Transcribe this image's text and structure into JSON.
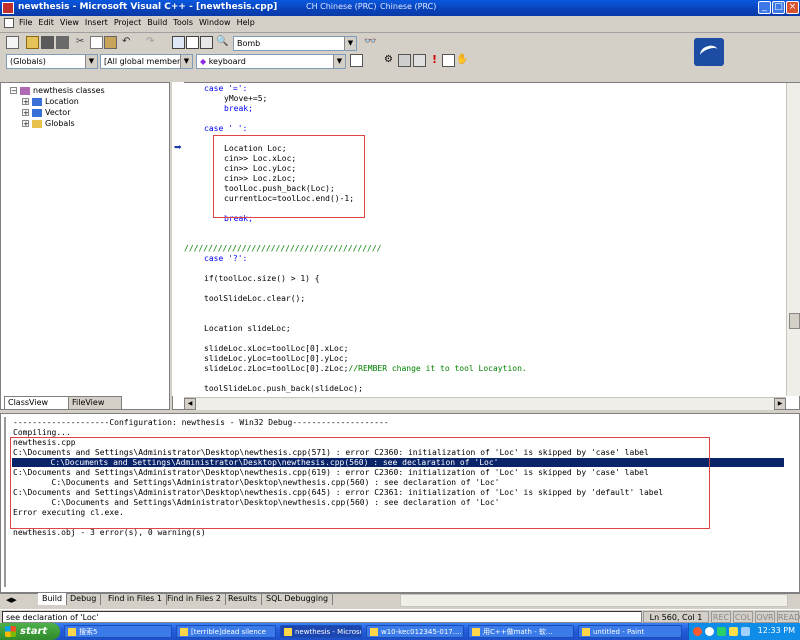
{
  "window": {
    "title": "newthesis - Microsoft Visual C++ - [newthesis.cpp]",
    "lang1": "CH Chinese (PRC)",
    "lang2": "Chinese (PRC)"
  },
  "menu": [
    "File",
    "Edit",
    "View",
    "Insert",
    "Project",
    "Build",
    "Tools",
    "Window",
    "Help"
  ],
  "toolbar": {
    "find_combo": "Bomb",
    "globals_combo": "(Globals)",
    "members_combo": "[All global members",
    "function_combo": "keyboard"
  },
  "classview": {
    "root": "newthesis classes",
    "items": [
      "Location",
      "Vector",
      "Globals"
    ],
    "tabs": [
      "ClassView",
      "FileView"
    ]
  },
  "code": [
    {
      "t": "case '=':",
      "x": 30,
      "k": true
    },
    {
      "t": "yMove+=5;",
      "x": 50
    },
    {
      "t": "break;",
      "x": 50,
      "k": true
    },
    {
      "t": "",
      "x": 0
    },
    {
      "t": "case ' ':",
      "x": 30,
      "k": true
    },
    {
      "t": "",
      "x": 0
    },
    {
      "t": "Location Loc;",
      "x": 50
    },
    {
      "t": "cin>> Loc.xLoc;",
      "x": 50
    },
    {
      "t": "cin>> Loc.yLoc;",
      "x": 50
    },
    {
      "t": "cin>> Loc.zLoc;",
      "x": 50
    },
    {
      "t": "toolLoc.push_back(Loc);",
      "x": 50
    },
    {
      "t": "currentLoc=toolLoc.end()-1;",
      "x": 50
    },
    {
      "t": "",
      "x": 0
    },
    {
      "t": "break;",
      "x": 50,
      "k": true
    },
    {
      "t": "",
      "x": 0
    },
    {
      "t": "",
      "x": 0
    },
    {
      "t": "/////////////////////////////////////////",
      "x": 10,
      "c": true
    },
    {
      "t": "case '?':",
      "x": 30,
      "k": true
    },
    {
      "t": "",
      "x": 0
    },
    {
      "t": "if(toolLoc.size() > 1) {",
      "x": 30
    },
    {
      "t": "",
      "x": 0
    },
    {
      "t": "toolSlideLoc.clear();",
      "x": 30
    },
    {
      "t": "",
      "x": 0
    },
    {
      "t": "",
      "x": 0
    },
    {
      "t": "Location slideLoc;",
      "x": 30
    },
    {
      "t": "",
      "x": 0
    },
    {
      "t": "slideLoc.xLoc=toolLoc[0].xLoc;",
      "x": 30
    },
    {
      "t": "slideLoc.yLoc=toolLoc[0].yLoc;",
      "x": 30
    },
    {
      "t": "slideLoc.zLoc=toolLoc[0].zLoc;",
      "x": 30,
      "tail": "//REMBER change it to tool Locaytion."
    },
    {
      "t": "",
      "x": 0
    },
    {
      "t": "toolSlideLoc.push_back(slideLoc);",
      "x": 30
    }
  ],
  "output": {
    "lines": [
      "--------------------Configuration: newthesis - Win32 Debug--------------------",
      "Compiling...",
      "newthesis.cpp",
      "C:\\Documents and Settings\\Administrator\\Desktop\\newthesis.cpp(571) : error C2360: initialization of 'Loc' is skipped by 'case' label",
      "        C:\\Documents and Settings\\Administrator\\Desktop\\newthesis.cpp(560) : see declaration of 'Loc'",
      "C:\\Documents and Settings\\Administrator\\Desktop\\newthesis.cpp(619) : error C2360: initialization of 'Loc' is skipped by 'case' label",
      "        C:\\Documents and Settings\\Administrator\\Desktop\\newthesis.cpp(560) : see declaration of 'Loc'",
      "C:\\Documents and Settings\\Administrator\\Desktop\\newthesis.cpp(645) : error C2361: initialization of 'Loc' is skipped by 'default' label",
      "        C:\\Documents and Settings\\Administrator\\Desktop\\newthesis.cpp(560) : see declaration of 'Loc'",
      "Error executing cl.exe.",
      "",
      "newthesis.obj - 3 error(s), 0 warning(s)"
    ],
    "highlight_index": 4,
    "tabs": [
      "Build",
      "Debug",
      "Find in Files 1",
      "Find in Files 2",
      "Results",
      "SQL Debugging"
    ]
  },
  "status": {
    "message": "see declaration of 'Loc'",
    "position": "Ln 560, Col 1",
    "indicators": [
      "REC",
      "COL",
      "OVR",
      "READ"
    ]
  },
  "taskbar": {
    "start": "start",
    "items": [
      "搜索5",
      "[terrible]dead silence",
      "newthesis - Microsoft...",
      "w10-kec012345-017....",
      "用C++做math - 软...",
      "untitled - Paint"
    ],
    "active_index": 2,
    "clock": "12:33 PM"
  }
}
